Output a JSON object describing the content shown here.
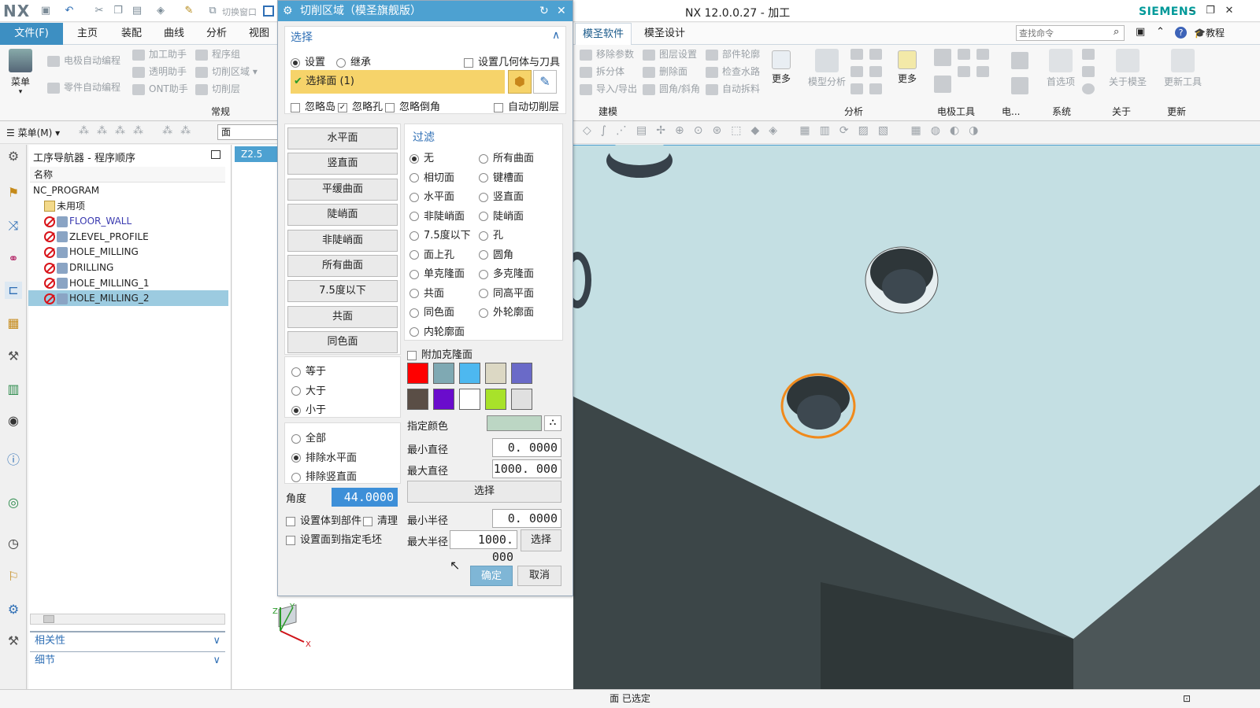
{
  "app": {
    "logo": "NX",
    "window_title": "NX 12.0.0.27 - 加工",
    "brand": "SIEMENS",
    "switch_window_label": "切换窗口"
  },
  "menu_tabs": [
    "文件(F)",
    "主页",
    "装配",
    "曲线",
    "分析",
    "视图"
  ],
  "right_tabs": [
    "模圣软件",
    "模圣设计"
  ],
  "search": {
    "placeholder": "查找命令"
  },
  "help_label": "教程",
  "ribbon_left": {
    "menu_label": "菜单",
    "items": [
      "电极自动编程",
      "加工助手",
      "程序组",
      "零件自动编程",
      "透明助手",
      "切削区域",
      "ONT助手",
      "切削层"
    ],
    "group_label": "常规"
  },
  "ribbon_right": {
    "build_items": [
      "移除参数",
      "图层设置",
      "部件轮廓",
      "拆分体",
      "删除面",
      "检查水路",
      "导入/导出",
      "圆角/斜角",
      "自动拆料"
    ],
    "more1": "更多",
    "analysis_items": [
      "模型分析"
    ],
    "more2": "更多",
    "groups": [
      "建模",
      "分析",
      "电极工具",
      "电...",
      "系统",
      "关于",
      "更新"
    ],
    "system_items": [
      "首选项",
      "关于模圣",
      "更新工具"
    ]
  },
  "toolbar": {
    "menu_label": "菜单(M)",
    "filter_value": "面"
  },
  "navigator": {
    "title": "工序导航器 - 程序顺序",
    "column": "名称",
    "rows": [
      {
        "label": "NC_PROGRAM",
        "level": 0,
        "icon": "none"
      },
      {
        "label": "未用项",
        "level": 1,
        "icon": "folder"
      },
      {
        "label": "FLOOR_WALL",
        "level": 1,
        "icon": "op",
        "color": "#3a3ab0"
      },
      {
        "label": "ZLEVEL_PROFILE",
        "level": 1,
        "icon": "op",
        "color": "#222"
      },
      {
        "label": "HOLE_MILLING",
        "level": 1,
        "icon": "op",
        "color": "#222"
      },
      {
        "label": "DRILLING",
        "level": 1,
        "icon": "op",
        "color": "#222"
      },
      {
        "label": "HOLE_MILLING_1",
        "level": 1,
        "icon": "op",
        "color": "#222"
      },
      {
        "label": "HOLE_MILLING_2",
        "level": 1,
        "icon": "op",
        "color": "#222",
        "selected": true
      }
    ],
    "sections": [
      "相关性",
      "细节"
    ]
  },
  "graphics_tab": "Z2.5",
  "dialog": {
    "title": "切削区域（模圣旗舰版）",
    "select_header": "选择",
    "mode_set": "设置",
    "mode_inherit": "继承",
    "set_geom_tool": "设置几何体与刀具",
    "select_face": "选择面 (1)",
    "ignore_island": "忽略岛",
    "ignore_hole": "忽略孔",
    "ignore_chamfer": "忽略倒角",
    "auto_cut_layer": "自动切削层",
    "left_buttons": [
      "水平面",
      "竖直面",
      "平缓曲面",
      "陡峭面",
      "非陡峭面",
      "所有曲面",
      "7.5度以下",
      "共面",
      "同色面"
    ],
    "compare": [
      "等于",
      "大于",
      "小于"
    ],
    "compare_selected": 2,
    "scope": [
      "全部",
      "排除水平面",
      "排除竖直面"
    ],
    "scope_selected": 1,
    "angle_label": "角度",
    "angle_value": "44.0000",
    "set_body_part": "设置体到部件",
    "clean": "清理",
    "set_face_blank": "设置面到指定毛坯",
    "filter_header": "过滤",
    "filters": [
      "无",
      "所有曲面",
      "相切面",
      "键槽面",
      "水平面",
      "竖直面",
      "非陡峭面",
      "陡峭面",
      "7.5度以下",
      "孔",
      "面上孔",
      "圆角",
      "单克隆面",
      "多克隆面",
      "共面",
      "同高平面",
      "同色面",
      "外轮廓面",
      "内轮廓面"
    ],
    "filter_selected": 0,
    "add_clone": "附加克隆面",
    "swatches": [
      "#ff0000",
      "#7fa9b3",
      "#4db8f0",
      "#dcd8c4",
      "#6a6ac8",
      "#5a4e46",
      "#6a0ccc",
      "#ffffff",
      "#a8e22a",
      "#e0e0e0"
    ],
    "specify_color": "指定颜色",
    "specify_color_value": "#bcd6c4",
    "min_dia_label": "最小直径",
    "min_dia": "0. 0000",
    "max_dia_label": "最大直径",
    "max_dia": "1000. 000",
    "select_btn": "选择",
    "min_rad_label": "最小半径",
    "min_rad": "0. 0000",
    "max_rad_label": "最大半径",
    "max_rad": "1000. 000",
    "select_btn2": "选择",
    "ok": "确定",
    "cancel": "取消"
  },
  "status": "面 已选定",
  "colors": {
    "accent": "#3d8fc2",
    "dialog_title": "#4da1d1",
    "highlight": "#f6d36a",
    "model_top": "#c4dfe3",
    "model_side": "#3c4648",
    "edge_select": "#f08a1c"
  }
}
